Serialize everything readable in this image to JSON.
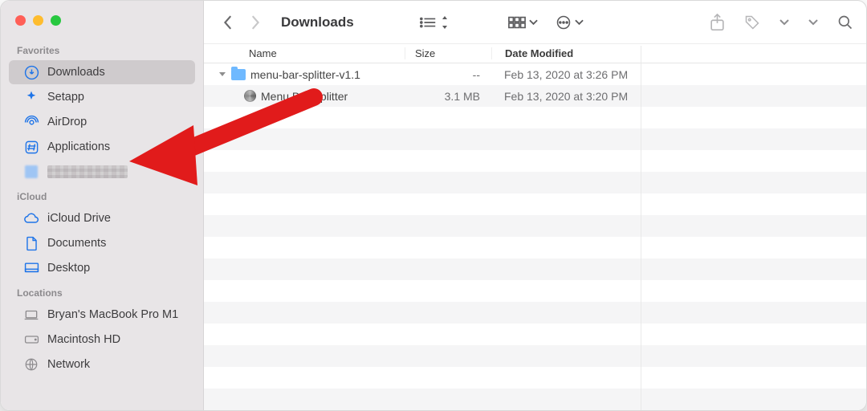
{
  "window_title": "Downloads",
  "traffic_lights": {
    "close": "#ff5f57",
    "min": "#febc2e",
    "max": "#28c840"
  },
  "sidebar": {
    "sections": [
      {
        "label": "Favorites",
        "items": [
          {
            "icon": "download-circle-icon",
            "label": "Downloads",
            "selected": true
          },
          {
            "icon": "setapp-icon",
            "label": "Setapp"
          },
          {
            "icon": "airdrop-icon",
            "label": "AirDrop"
          },
          {
            "icon": "applications-icon",
            "label": "Applications"
          },
          {
            "icon": "blurred-icon",
            "label": "",
            "blurred": true
          }
        ]
      },
      {
        "label": "iCloud",
        "items": [
          {
            "icon": "icloud-icon",
            "label": "iCloud Drive"
          },
          {
            "icon": "document-icon",
            "label": "Documents"
          },
          {
            "icon": "desktop-icon",
            "label": "Desktop"
          }
        ]
      },
      {
        "label": "Locations",
        "items": [
          {
            "icon": "laptop-icon",
            "label": "Bryan's MacBook Pro M1"
          },
          {
            "icon": "disk-icon",
            "label": "Macintosh HD"
          },
          {
            "icon": "network-icon",
            "label": "Network"
          }
        ]
      }
    ]
  },
  "toolbar": {
    "back_enabled": true,
    "forward_enabled": false,
    "view_list": true,
    "view_grid": true
  },
  "columns": {
    "name": "Name",
    "size": "Size",
    "date": "Date Modified"
  },
  "rows": [
    {
      "expanded": true,
      "type": "folder",
      "name": "menu-bar-splitter-v1.1",
      "size": "--",
      "date": "Feb 13, 2020 at 3:26 PM"
    },
    {
      "indent": 1,
      "type": "app",
      "name": "Menu Bar Splitter",
      "size": "3.1 MB",
      "date": "Feb 13, 2020 at 3:20 PM"
    }
  ],
  "annotation": {
    "type": "arrow",
    "color": "#e11b1b",
    "target": "sidebar-item-applications"
  }
}
